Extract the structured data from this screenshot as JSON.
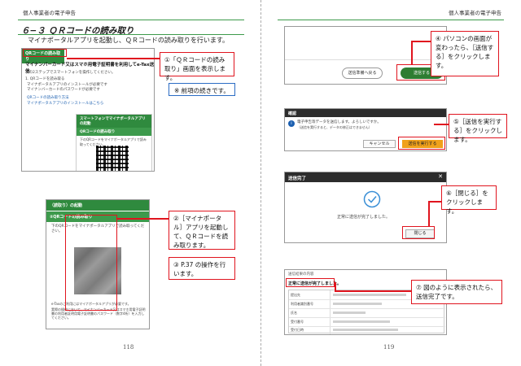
{
  "left_page": {
    "header": "個人事業者の電子申告",
    "section_title": "６−３ ＱＲコードの読み取り",
    "section_sub": "マイナポータルアプリを起動し、ＱＲコードの読み取りを行います。",
    "shot1": {
      "bar_label": "QRコードの読み取り",
      "heading": "マイナンバーカード又はスマホ用電子証明書を利用してe-Tax送信",
      "line1": "次の2ステップでスマートフォンを操作してください。",
      "line2": "1. QRコードを読み取る",
      "note_a": "マイナポータルアプリのインストールが必要です",
      "note_b": "マイナンバーカードのパスワードが必要です",
      "link1": "QRコードの読み取り方法",
      "link2": "マイナポータルアプリのインストールはこちら",
      "panel_title": "スマートフォンでマイナポータルアプリの起動",
      "panel_sub": "QRコードの読み取り",
      "panel_text": "下のQRコードをマイナポータルアプリで読み取ってください。"
    },
    "callout1": "①「ＱＲコードの読み取り」画面を表示します。",
    "note_blue": "※ 前項の続きです。",
    "shot2": {
      "top_label": "（読取り）の起動",
      "bar_label": "②QRコードの読み取り",
      "text": "下のQRコードをマイナポータルアプリで読み取ってください。",
      "footnote1": "e-Taxのご利用にはマイナポータルアプリが必要です。",
      "footnote2": "実際の操作において、マイナンバーカード又はスマホ用電子証明書の利用者証明用電子証明書のパスワード（数字4桁）を入力してください。"
    },
    "callout2": "②［マイナポータル］アプリを起動して、ＱＲコードを読み取ります。",
    "callout3": "③ P.37 の操作を行います。",
    "page_number": "118"
  },
  "right_page": {
    "header": "個人事業者の電子申告",
    "shot1": {
      "back_button": "送信準備へ戻る",
      "send_button": "送信する"
    },
    "callout4": "④ パソコンの画面が変わったら、［送信する］をクリックします。",
    "shot2": {
      "title": "確認",
      "message": "電子申告等データを送信します。よろしいですか。",
      "sub": "（送信を実行すると、データの修正はできません）",
      "cancel_button": "キャンセル",
      "exec_button": "送信を実行する"
    },
    "callout5": "⑤［送信を実行する］をクリックします。",
    "shot3": {
      "title": "送信完了",
      "close_glyph": "✕",
      "message": "正常に送信が完了しました。",
      "close_button": "閉じる"
    },
    "callout6": "⑥［閉じる］をクリックします。",
    "shot4": {
      "header": "送信結果の内容",
      "status": "正常に送信が完了しました。",
      "row_labels": [
        "提出先",
        "利用者識別番号",
        "氏名",
        "受付番号",
        "受付日時"
      ]
    },
    "callout7": "⑦ 図のように表示されたら、送信完了です。",
    "page_number": "119"
  },
  "colors": {
    "accent_green": "#2f8a3e",
    "callout_red": "#e0141e",
    "note_blue": "#2b6cc4",
    "send_green": "#2e7d32",
    "exec_orange": "#f0a11a"
  }
}
